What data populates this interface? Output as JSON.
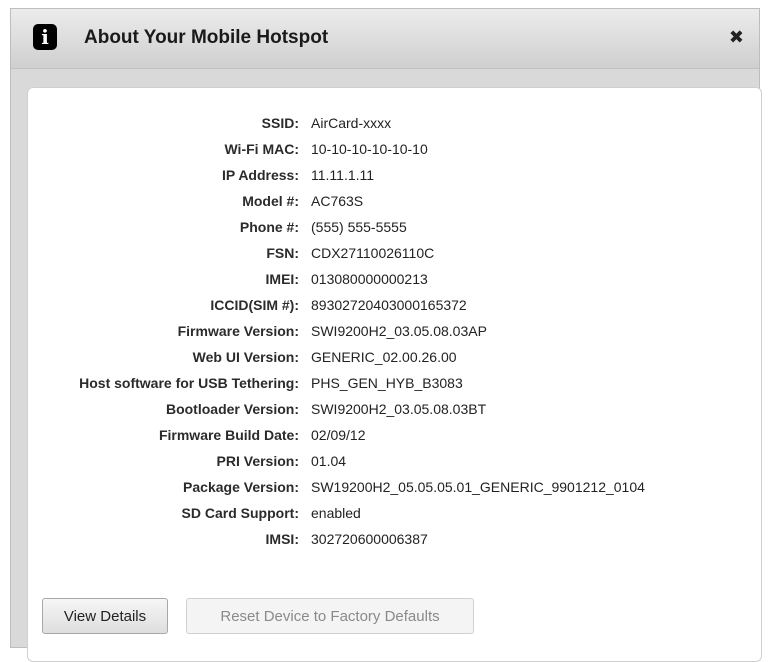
{
  "dialog": {
    "title": "About Your Mobile Hotspot",
    "close_label": "✖",
    "info_glyph": "i"
  },
  "info": [
    {
      "label": "SSID:",
      "value": "AirCard-xxxx"
    },
    {
      "label": "Wi-Fi MAC:",
      "value": "10-10-10-10-10-10"
    },
    {
      "label": "IP Address:",
      "value": "11.11.1.11"
    },
    {
      "label": "Model #:",
      "value": "AC763S"
    },
    {
      "label": "Phone #:",
      "value": "(555) 555-5555"
    },
    {
      "label": "FSN:",
      "value": "CDX27110026110C"
    },
    {
      "label": "IMEI:",
      "value": "013080000000213"
    },
    {
      "label": "ICCID(SIM #):",
      "value": "89302720403000165372"
    },
    {
      "label": "Firmware Version:",
      "value": "SWI9200H2_03.05.08.03AP"
    },
    {
      "label": "Web UI Version:",
      "value": "GENERIC_02.00.26.00"
    },
    {
      "label": "Host software for USB Tethering:",
      "value": "PHS_GEN_HYB_B3083"
    },
    {
      "label": "Bootloader Version:",
      "value": "SWI9200H2_03.05.08.03BT"
    },
    {
      "label": "Firmware Build Date:",
      "value": "02/09/12"
    },
    {
      "label": "PRI Version:",
      "value": "01.04"
    },
    {
      "label": "Package Version:",
      "value": "SW19200H2_05.05.05.01_GENERIC_9901212_0104"
    },
    {
      "label": "SD Card Support:",
      "value": "enabled"
    },
    {
      "label": "IMSI:",
      "value": "302720600006387"
    }
  ],
  "buttons": {
    "view_details": "View Details",
    "reset": "Reset Device to Factory Defaults"
  }
}
